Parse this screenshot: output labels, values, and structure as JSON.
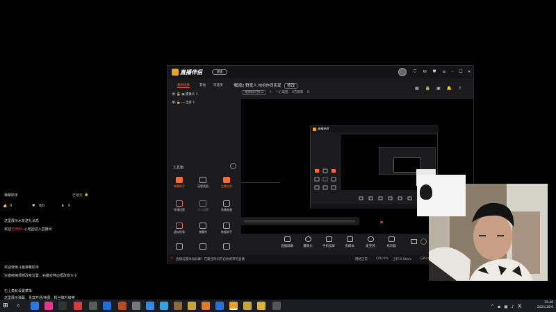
{
  "danmu": {
    "header_left": "弹幕助手",
    "header_right": "已锁定",
    "stats": [
      "0",
      "0/0",
      "0"
    ],
    "lines_top": [
      "这里展示水友送礼消息",
      "欢迎"
    ],
    "welcome_name": "王明明",
    "welcome_rest": "--心电回进入直播间",
    "lines_bottom": [
      "欢迎使用斗鱼弹幕助手",
      "左键拖拽顶部改变位置，右键拉伸边框改变大小",
      "右上角有设置菜单",
      "这里展示弹幕、贵宾开通/续费、粉丝牌升级等"
    ]
  },
  "app": {
    "logo": "直播伴侣",
    "version_label": "测版",
    "scene_tabs": [
      "我的场景",
      "其他",
      "可选项"
    ],
    "add_symbol": "+",
    "scenes": [
      "摄像头 1",
      "全屏 1"
    ],
    "stream_title": "细观2 野宽人 地扮作同实现",
    "edit_label": "修改",
    "sub_info": [
      "相册取可接口",
      "一心电脑",
      "0方刷新",
      "0"
    ],
    "toolbox_title": "工具箱",
    "tools": [
      "弹幕助手",
      "宠管奖励",
      "主播任务",
      "开播设置",
      "主人设置",
      "直播准备",
      "虚拟形象",
      "弹幕秀",
      "数据助手",
      "",
      "",
      ""
    ],
    "bottom_items": [
      "直播屏幕",
      "摄像头",
      "手机投屏",
      "多媒体",
      "麦克风",
      "扬声器"
    ],
    "status_text": "直播设置添加屏幕？在最佳时间开启你要带的直播",
    "status_right": [
      "网络正常",
      "CPU:0%",
      "上行:0.0kb/s",
      "GPU:0%"
    ]
  },
  "nested": {
    "logo": "直播伴侣"
  },
  "taskbar": {
    "time": "15:48",
    "date": "2021/10/6"
  },
  "colors": {
    "accent_orange": "#ff6a2c",
    "logo_yellow": "#e8a22a",
    "danmu_red": "#ff3b3b"
  }
}
